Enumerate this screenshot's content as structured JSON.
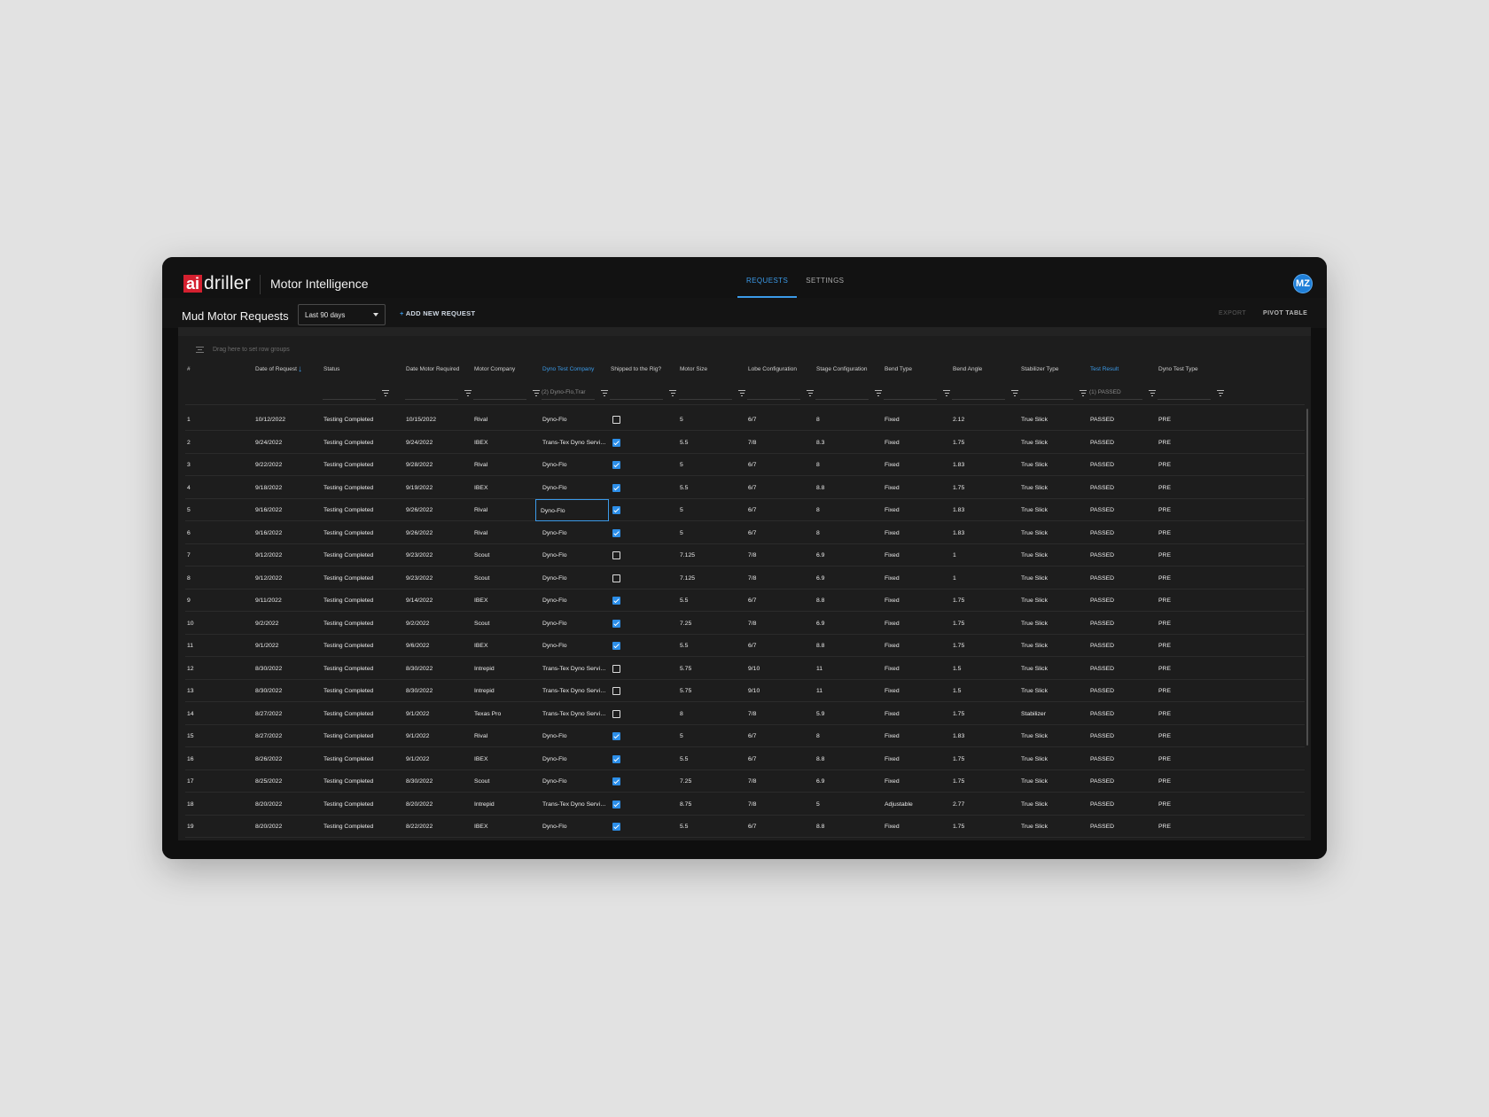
{
  "app": {
    "logo_ai": "ai",
    "logo_driller": "driller",
    "title": "Motor Intelligence",
    "avatar_initials": "MZ",
    "accent_color": "#3b9ae8",
    "brand_color": "#d4202f"
  },
  "nav": {
    "tabs": [
      {
        "label": "REQUESTS",
        "active": true
      },
      {
        "label": "SETTINGS",
        "active": false
      }
    ]
  },
  "toolbar": {
    "page_title": "Mud Motor Requests",
    "date_range": "Last 90 days",
    "add_request_icon": "+",
    "add_request_label": "ADD NEW REQUEST",
    "export_label": "EXPORT",
    "pivot_label": "PIVOT TABLE"
  },
  "grid": {
    "group_panel_text": "Drag here to set row groups",
    "sort_icon": "arrow-down-icon",
    "columns": [
      {
        "label": "#"
      },
      {
        "label": "Date of Request"
      },
      {
        "label": "Status"
      },
      {
        "label": "Date Motor Required"
      },
      {
        "label": "Motor Company"
      },
      {
        "label": "Dyno Test Company"
      },
      {
        "label": "Shipped to the Rig?"
      },
      {
        "label": "Motor Size"
      },
      {
        "label": "Lobe Configuration"
      },
      {
        "label": "Stage Configuration"
      },
      {
        "label": "Bend Type"
      },
      {
        "label": "Bend Angle"
      },
      {
        "label": "Stabilizer Type"
      },
      {
        "label": "Test Result"
      },
      {
        "label": "Dyno Test Type"
      }
    ],
    "filters": {
      "dyno_test_company": "(2) Dyno-Flo,Trar",
      "test_result": "(1) PASSED"
    },
    "rows": [
      {
        "n": "1",
        "date": "10/12/2022",
        "status": "Testing Completed",
        "required": "10/15/2022",
        "company": "Rival",
        "dyno": "Dyno-Flo",
        "shipped": false,
        "size": "5",
        "lobe": "6/7",
        "stage": "8",
        "bend_type": "Fixed",
        "bend_angle": "2.12",
        "stab": "True Slick",
        "result": "PASSED",
        "test_type": "PRE"
      },
      {
        "n": "2",
        "date": "9/24/2022",
        "status": "Testing Completed",
        "required": "9/24/2022",
        "company": "IBEX",
        "dyno": "Trans-Tex Dyno Services",
        "shipped": true,
        "size": "5.5",
        "lobe": "7/8",
        "stage": "8.3",
        "bend_type": "Fixed",
        "bend_angle": "1.75",
        "stab": "True Slick",
        "result": "PASSED",
        "test_type": "PRE"
      },
      {
        "n": "3",
        "date": "9/22/2022",
        "status": "Testing Completed",
        "required": "9/28/2022",
        "company": "Rival",
        "dyno": "Dyno-Flo",
        "shipped": true,
        "size": "5",
        "lobe": "6/7",
        "stage": "8",
        "bend_type": "Fixed",
        "bend_angle": "1.83",
        "stab": "True Slick",
        "result": "PASSED",
        "test_type": "PRE"
      },
      {
        "n": "4",
        "date": "9/18/2022",
        "status": "Testing Completed",
        "required": "9/19/2022",
        "company": "IBEX",
        "dyno": "Dyno-Flo",
        "shipped": true,
        "size": "5.5",
        "lobe": "6/7",
        "stage": "8.8",
        "bend_type": "Fixed",
        "bend_angle": "1.75",
        "stab": "True Slick",
        "result": "PASSED",
        "test_type": "PRE"
      },
      {
        "n": "5",
        "date": "9/16/2022",
        "status": "Testing Completed",
        "required": "9/26/2022",
        "company": "Rival",
        "dyno": "Dyno-Flo",
        "shipped": true,
        "size": "5",
        "lobe": "6/7",
        "stage": "8",
        "bend_type": "Fixed",
        "bend_angle": "1.83",
        "stab": "True Slick",
        "result": "PASSED",
        "test_type": "PRE",
        "focus": true
      },
      {
        "n": "6",
        "date": "9/16/2022",
        "status": "Testing Completed",
        "required": "9/26/2022",
        "company": "Rival",
        "dyno": "Dyno-Flo",
        "shipped": true,
        "size": "5",
        "lobe": "6/7",
        "stage": "8",
        "bend_type": "Fixed",
        "bend_angle": "1.83",
        "stab": "True Slick",
        "result": "PASSED",
        "test_type": "PRE"
      },
      {
        "n": "7",
        "date": "9/12/2022",
        "status": "Testing Completed",
        "required": "9/23/2022",
        "company": "Scout",
        "dyno": "Dyno-Flo",
        "shipped": false,
        "size": "7.125",
        "lobe": "7/8",
        "stage": "6.9",
        "bend_type": "Fixed",
        "bend_angle": "1",
        "stab": "True Slick",
        "result": "PASSED",
        "test_type": "PRE"
      },
      {
        "n": "8",
        "date": "9/12/2022",
        "status": "Testing Completed",
        "required": "9/23/2022",
        "company": "Scout",
        "dyno": "Dyno-Flo",
        "shipped": false,
        "size": "7.125",
        "lobe": "7/8",
        "stage": "6.9",
        "bend_type": "Fixed",
        "bend_angle": "1",
        "stab": "True Slick",
        "result": "PASSED",
        "test_type": "PRE"
      },
      {
        "n": "9",
        "date": "9/11/2022",
        "status": "Testing Completed",
        "required": "9/14/2022",
        "company": "IBEX",
        "dyno": "Dyno-Flo",
        "shipped": true,
        "size": "5.5",
        "lobe": "6/7",
        "stage": "8.8",
        "bend_type": "Fixed",
        "bend_angle": "1.75",
        "stab": "True Slick",
        "result": "PASSED",
        "test_type": "PRE"
      },
      {
        "n": "10",
        "date": "9/2/2022",
        "status": "Testing Completed",
        "required": "9/2/2022",
        "company": "Scout",
        "dyno": "Dyno-Flo",
        "shipped": true,
        "size": "7.25",
        "lobe": "7/8",
        "stage": "6.9",
        "bend_type": "Fixed",
        "bend_angle": "1.75",
        "stab": "True Slick",
        "result": "PASSED",
        "test_type": "PRE"
      },
      {
        "n": "11",
        "date": "9/1/2022",
        "status": "Testing Completed",
        "required": "9/6/2022",
        "company": "IBEX",
        "dyno": "Dyno-Flo",
        "shipped": true,
        "size": "5.5",
        "lobe": "6/7",
        "stage": "8.8",
        "bend_type": "Fixed",
        "bend_angle": "1.75",
        "stab": "True Slick",
        "result": "PASSED",
        "test_type": "PRE"
      },
      {
        "n": "12",
        "date": "8/30/2022",
        "status": "Testing Completed",
        "required": "8/30/2022",
        "company": "Intrepid",
        "dyno": "Trans-Tex Dyno Services",
        "shipped": false,
        "size": "5.75",
        "lobe": "9/10",
        "stage": "11",
        "bend_type": "Fixed",
        "bend_angle": "1.5",
        "stab": "True Slick",
        "result": "PASSED",
        "test_type": "PRE"
      },
      {
        "n": "13",
        "date": "8/30/2022",
        "status": "Testing Completed",
        "required": "8/30/2022",
        "company": "Intrepid",
        "dyno": "Trans-Tex Dyno Services",
        "shipped": false,
        "size": "5.75",
        "lobe": "9/10",
        "stage": "11",
        "bend_type": "Fixed",
        "bend_angle": "1.5",
        "stab": "True Slick",
        "result": "PASSED",
        "test_type": "PRE"
      },
      {
        "n": "14",
        "date": "8/27/2022",
        "status": "Testing Completed",
        "required": "9/1/2022",
        "company": "Texas Pro",
        "dyno": "Trans-Tex Dyno Services",
        "shipped": false,
        "size": "8",
        "lobe": "7/8",
        "stage": "5.9",
        "bend_type": "Fixed",
        "bend_angle": "1.75",
        "stab": "Stabilizer",
        "result": "PASSED",
        "test_type": "PRE"
      },
      {
        "n": "15",
        "date": "8/27/2022",
        "status": "Testing Completed",
        "required": "9/1/2022",
        "company": "Rival",
        "dyno": "Dyno-Flo",
        "shipped": true,
        "size": "5",
        "lobe": "6/7",
        "stage": "8",
        "bend_type": "Fixed",
        "bend_angle": "1.83",
        "stab": "True Slick",
        "result": "PASSED",
        "test_type": "PRE"
      },
      {
        "n": "16",
        "date": "8/26/2022",
        "status": "Testing Completed",
        "required": "9/1/2022",
        "company": "IBEX",
        "dyno": "Dyno-Flo",
        "shipped": true,
        "size": "5.5",
        "lobe": "6/7",
        "stage": "8.8",
        "bend_type": "Fixed",
        "bend_angle": "1.75",
        "stab": "True Slick",
        "result": "PASSED",
        "test_type": "PRE"
      },
      {
        "n": "17",
        "date": "8/25/2022",
        "status": "Testing Completed",
        "required": "8/30/2022",
        "company": "Scout",
        "dyno": "Dyno-Flo",
        "shipped": true,
        "size": "7.25",
        "lobe": "7/8",
        "stage": "6.9",
        "bend_type": "Fixed",
        "bend_angle": "1.75",
        "stab": "True Slick",
        "result": "PASSED",
        "test_type": "PRE"
      },
      {
        "n": "18",
        "date": "8/20/2022",
        "status": "Testing Completed",
        "required": "8/20/2022",
        "company": "Intrepid",
        "dyno": "Trans-Tex Dyno Services",
        "shipped": true,
        "size": "8.75",
        "lobe": "7/8",
        "stage": "5",
        "bend_type": "Adjustable",
        "bend_angle": "2.77",
        "stab": "True Slick",
        "result": "PASSED",
        "test_type": "PRE"
      },
      {
        "n": "19",
        "date": "8/20/2022",
        "status": "Testing Completed",
        "required": "8/22/2022",
        "company": "IBEX",
        "dyno": "Dyno-Flo",
        "shipped": true,
        "size": "5.5",
        "lobe": "6/7",
        "stage": "8.8",
        "bend_type": "Fixed",
        "bend_angle": "1.75",
        "stab": "True Slick",
        "result": "PASSED",
        "test_type": "PRE"
      }
    ]
  }
}
